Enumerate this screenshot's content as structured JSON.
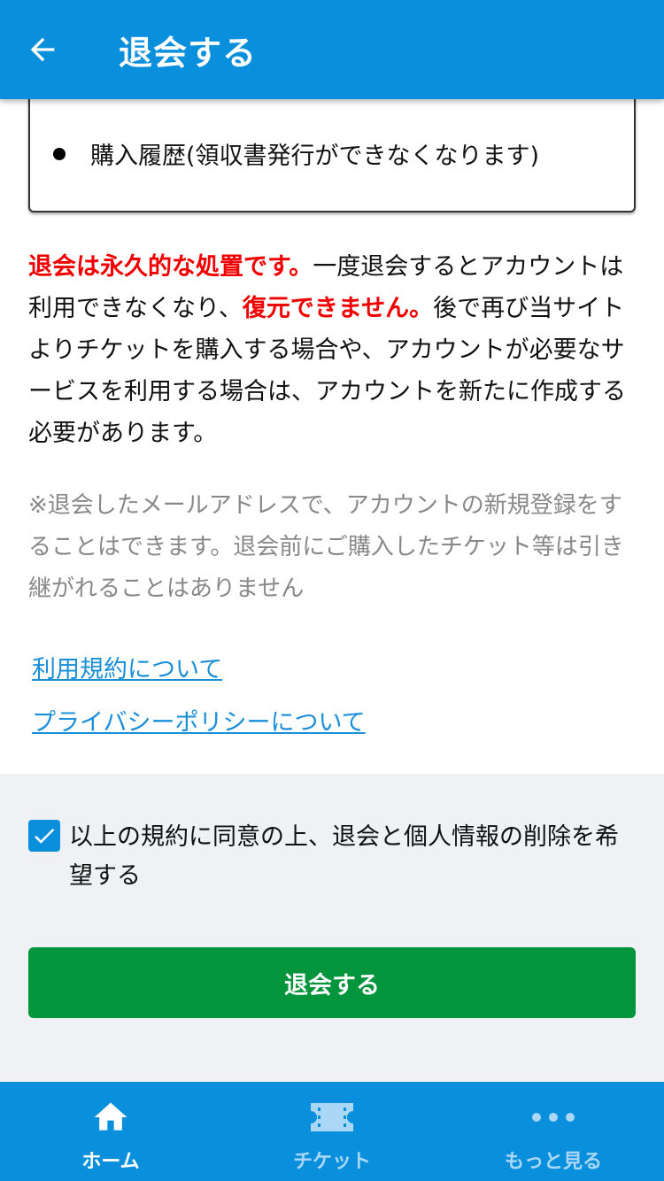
{
  "header": {
    "title": "退会する",
    "back_icon": "arrow-left-icon"
  },
  "data_list": {
    "items": [
      "購入履歴(領収書発行ができなくなります)"
    ]
  },
  "warning": {
    "red1": "退会は永久的な処置です。",
    "text1": "一度退会するとアカウントは利用できなくなり、",
    "red2": "復元できません。",
    "text2": "後で再び当サイトよりチケットを購入する場合や、アカウントが必要なサービスを利用する場合は、アカウントを新たに作成する必要があります。"
  },
  "note": "※退会したメールアドレスで、アカウントの新規登録をすることはできます。退会前にご購入したチケット等は引き継がれることはありません",
  "links": {
    "terms": "利用規約について",
    "privacy": "プライバシーポリシーについて"
  },
  "agreement": {
    "checked": true,
    "label": "以上の規約に同意の上、退会と個人情報の削除を希望する"
  },
  "submit": {
    "label": "退会する"
  },
  "bottom_nav": {
    "items": [
      {
        "label": "ホーム",
        "icon": "home-icon",
        "active": true
      },
      {
        "label": "チケット",
        "icon": "ticket-icon",
        "active": false
      },
      {
        "label": "もっと見る",
        "icon": "more-dots-icon",
        "active": false
      }
    ]
  },
  "colors": {
    "primary": "#0a8fdc",
    "danger": "#f00000",
    "success": "#02953b",
    "link": "#1a8fd9",
    "muted": "#888888",
    "nav_inactive": "#a9d7f5"
  }
}
